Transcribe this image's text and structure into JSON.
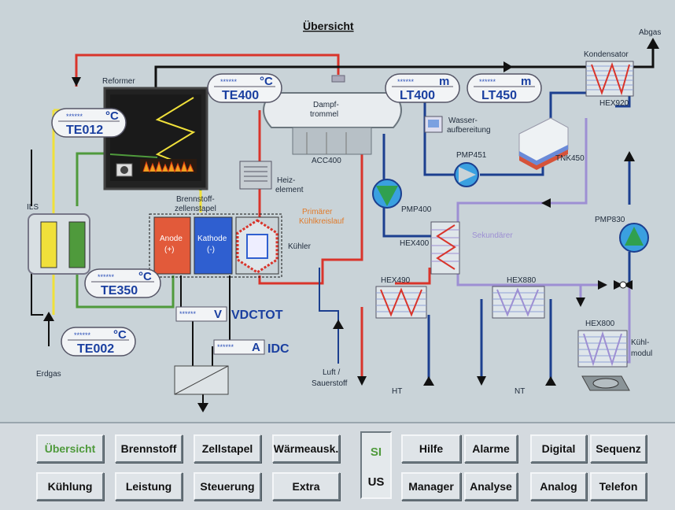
{
  "title": "Übersicht",
  "gauges": [
    {
      "id": "te012",
      "stars": "******",
      "unit": "°C",
      "name": "TE012"
    },
    {
      "id": "te400",
      "stars": "******",
      "unit": "°C",
      "name": "TE400"
    },
    {
      "id": "lt400",
      "stars": "******",
      "unit": "m",
      "name": "LT400"
    },
    {
      "id": "lt450",
      "stars": "******",
      "unit": "m",
      "name": "LT450"
    },
    {
      "id": "te350",
      "stars": "******",
      "unit": "°C",
      "name": "TE350"
    },
    {
      "id": "te002",
      "stars": "******",
      "unit": "°C",
      "name": "TE002"
    }
  ],
  "readouts": {
    "vdctot": {
      "stars": "******",
      "unit": "V",
      "name": "VDCTOT"
    },
    "idc": {
      "stars": "******",
      "unit": "A",
      "name": "IDC"
    }
  },
  "labels": {
    "reformer": "Reformer",
    "abgas": "Abgas",
    "kondensator": "Kondensator",
    "hex920": "HEX920",
    "dampf1": "Dampf-",
    "dampf2": "trommel",
    "acc400": "ACC400",
    "wasser1": "Wasser-",
    "wasser2": "aufbereitung",
    "pmp451": "PMP451",
    "tnk450": "TNK450",
    "pmp400": "PMP400",
    "heiz1": "Heiz-",
    "heiz2": "element",
    "brenn1": "Brennstoff-",
    "brenn2": "zellenstapel",
    "ils": "ILS",
    "anode1": "Anode",
    "anode2": "(+)",
    "kathode1": "Kathode",
    "kathode2": "(-)",
    "kuehler": "Kühler",
    "primaer1": "Primärer",
    "primaer2": "Kühlkreislauf",
    "sekundaer": "Sekundärer",
    "hex400": "HEX400",
    "pmp830": "PMP830",
    "hex490": "HEX490",
    "hex880": "HEX880",
    "hex800": "HEX800",
    "kuehl1": "Kühl-",
    "kuehl2": "modul",
    "erdgas": "Erdgas",
    "luft1": "Luft /",
    "luft2": "Sauerstoff",
    "ht": "HT",
    "nt": "NT"
  },
  "buttons": {
    "row1": [
      "Übersicht",
      "Brennstoff",
      "Zellstapel",
      "Wärmeausk."
    ],
    "row2": [
      "Kühlung",
      "Leistung",
      "Steuerung",
      "Extra"
    ],
    "mid1": [
      "Hilfe",
      "Alarme"
    ],
    "mid2": [
      "Manager",
      "Analyse"
    ],
    "right1": [
      "Digital",
      "Sequenz"
    ],
    "right2": [
      "Analog",
      "Telefon"
    ]
  },
  "units": {
    "si": "SI",
    "us": "US"
  },
  "colors": {
    "red": "#d9342b",
    "blue": "#1c3f8f",
    "yellow": "#f0e03a",
    "green": "#4f9a3c",
    "black": "#111111",
    "lightblue": "#8fa3d6",
    "lilac": "#9d8fd3",
    "orange": "#e07a2a",
    "anode": "#e25a3a",
    "kathode": "#2f5fd0",
    "pump": "#3aa0e0"
  }
}
